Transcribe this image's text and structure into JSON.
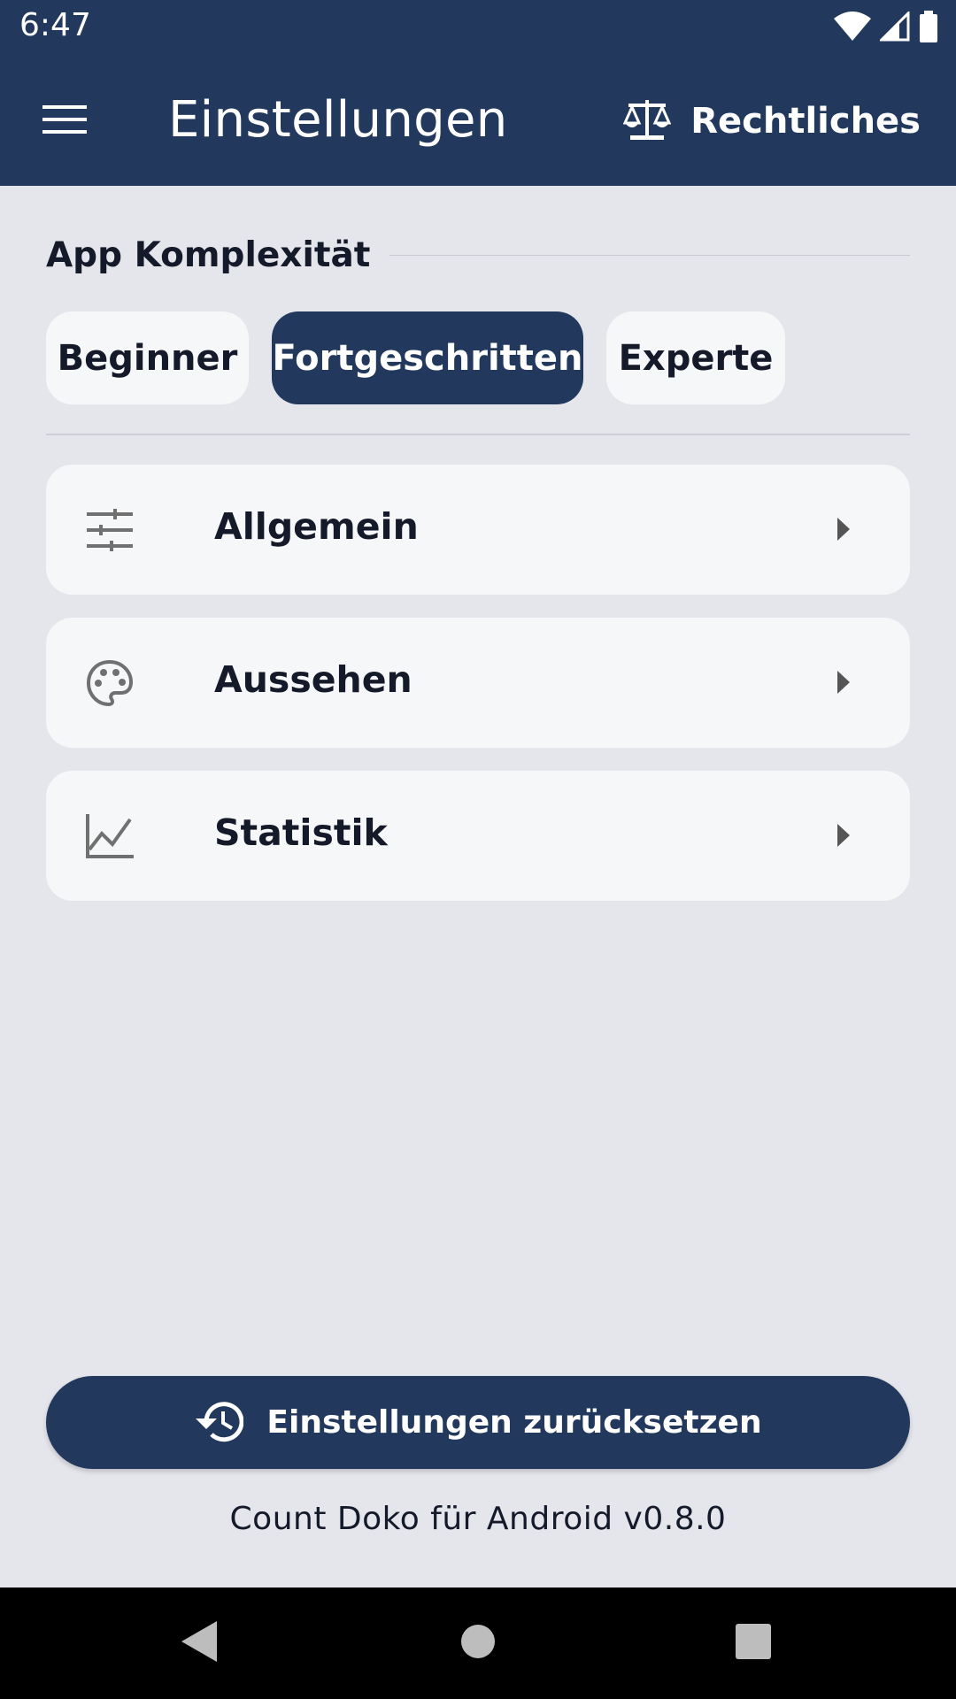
{
  "status_bar": {
    "time": "6:47",
    "icons": [
      "wifi-icon",
      "signal-icon",
      "battery-icon"
    ]
  },
  "app_bar": {
    "title": "Einstellungen",
    "menu_icon": "hamburger-menu-icon",
    "legal_icon": "scales-icon",
    "legal_label": "Rechtliches"
  },
  "complexity": {
    "title": "App Komplexität",
    "options": [
      {
        "label": "Beginner",
        "selected": false
      },
      {
        "label": "Fortgeschritten",
        "selected": true
      },
      {
        "label": "Experte",
        "selected": false
      }
    ]
  },
  "settings_items": [
    {
      "label": "Allgemein",
      "icon": "tune-sliders-icon"
    },
    {
      "label": "Aussehen",
      "icon": "palette-icon"
    },
    {
      "label": "Statistik",
      "icon": "line-chart-icon"
    }
  ],
  "reset": {
    "label": "Einstellungen zurücksetzen",
    "icon": "restore-history-icon"
  },
  "version_text": "Count Doko für Android v0.8.0",
  "colors": {
    "primary": "#22395d",
    "background": "#e5e6ec",
    "card": "#f6f7f9",
    "text": "#141a2a",
    "icon_gray": "#707070"
  }
}
